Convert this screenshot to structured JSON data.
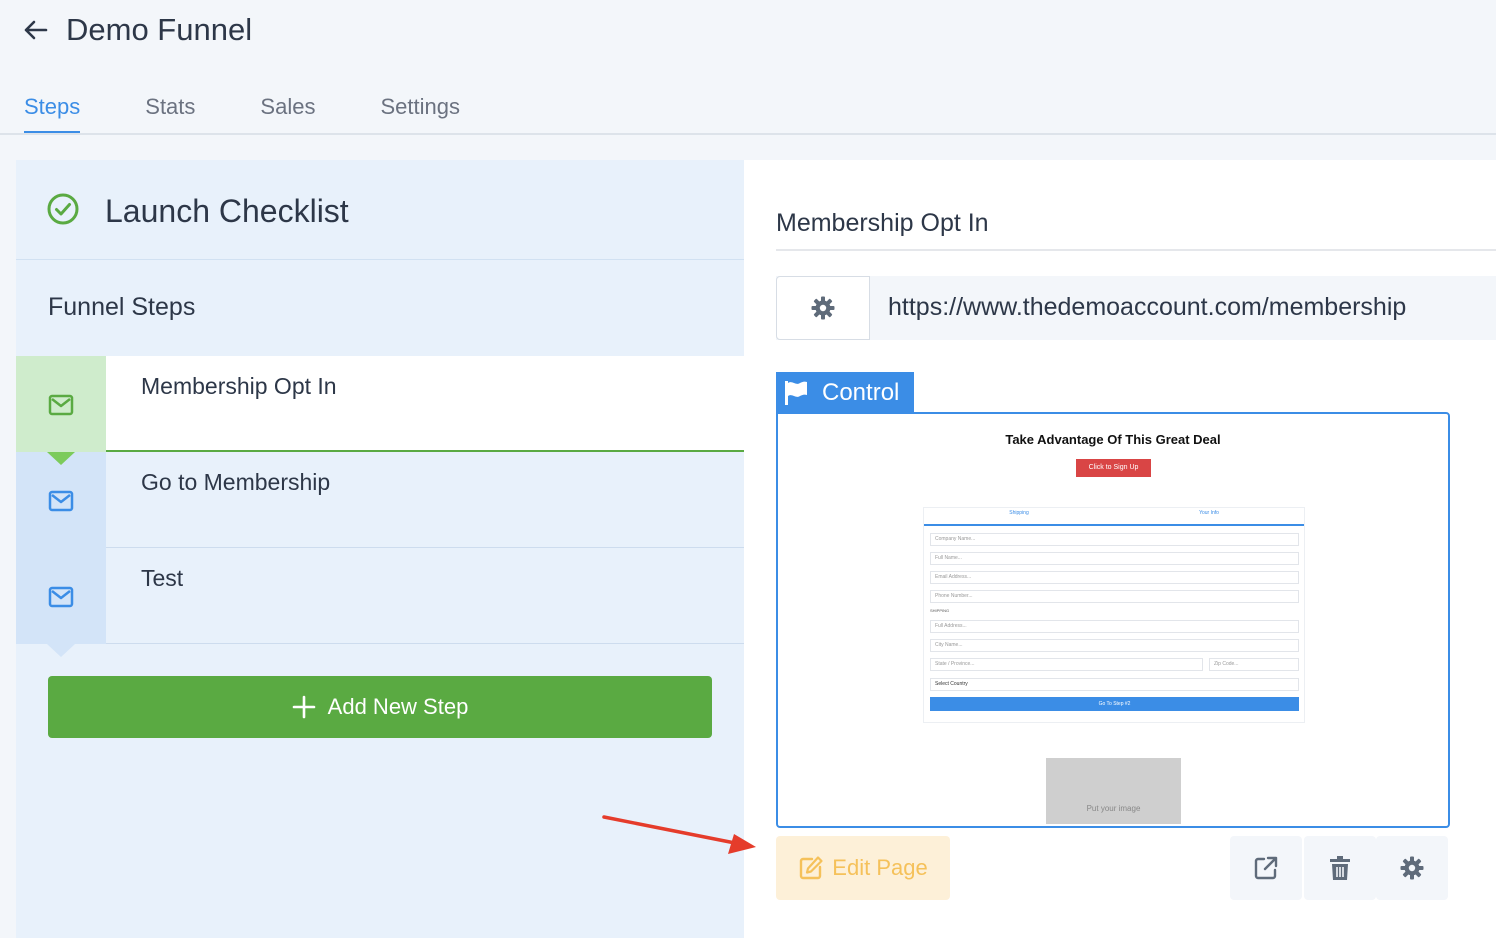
{
  "header": {
    "title": "Demo Funnel",
    "tabs": [
      {
        "label": "Steps",
        "active": true
      },
      {
        "label": "Stats",
        "active": false
      },
      {
        "label": "Sales",
        "active": false
      },
      {
        "label": "Settings",
        "active": false
      }
    ]
  },
  "sidebar": {
    "checklist_label": "Launch Checklist",
    "steps_heading": "Funnel Steps",
    "steps": [
      {
        "label": "Membership Opt In",
        "icon": "envelope-icon",
        "active": true
      },
      {
        "label": "Go to Membership",
        "icon": "envelope-icon",
        "active": false
      },
      {
        "label": "Test",
        "icon": "envelope-icon",
        "active": false
      }
    ],
    "add_step_label": "Add New Step"
  },
  "main": {
    "page_name": "Membership Opt In",
    "url": "https://www.thedemoaccount.com/membership",
    "variant_label": "Control",
    "preview": {
      "headline": "Take Advantage Of This Great Deal",
      "cta": "Click to Sign Up",
      "tab1": "Shipping",
      "tab2": "Your Info",
      "fields": [
        "Company Name...",
        "Full Name...",
        "Email Address...",
        "Phone Number...",
        "Full Address...",
        "City Name...",
        "State / Province...",
        "Zip Code...",
        "Select Country"
      ],
      "shipping_label": "SHIPPING",
      "submit": "Go To Step #2",
      "image_placeholder": "Put your image"
    },
    "edit_page_label": "Edit Page"
  },
  "colors": {
    "accent": "#3b8de6",
    "success": "#5aaa42",
    "warning": "#f5c15a",
    "annotation_arrow": "#e53c2b"
  }
}
